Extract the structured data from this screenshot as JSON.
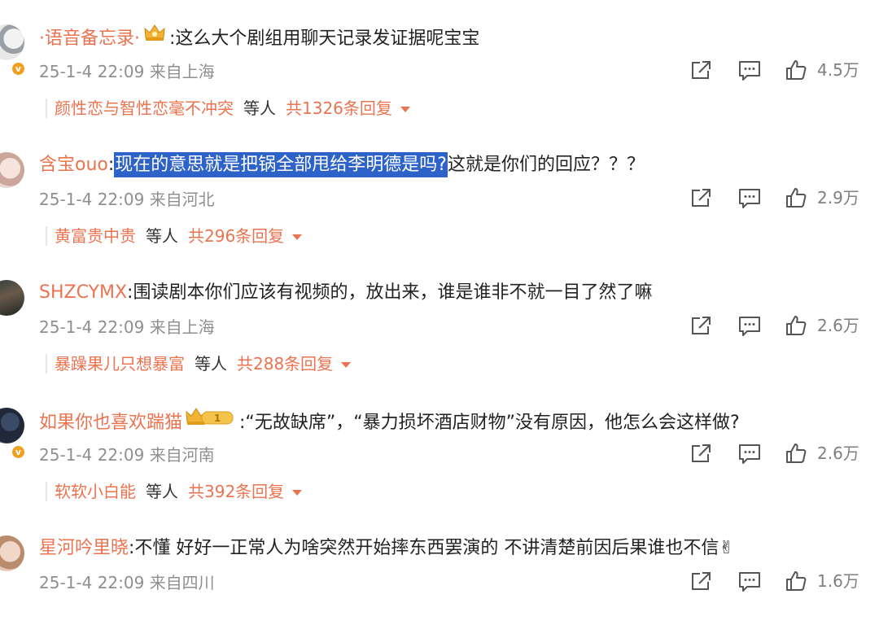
{
  "comments": [
    {
      "username": "·语音备忘录·",
      "medal": "crown-icon",
      "text_before": "",
      "text_highlight": "",
      "text_after": ":这么大个剧组用聊天记录发证据呢宝宝",
      "date": "25-1-4 22:09",
      "location": "来自上海",
      "likes": "4.5万",
      "reply_user": "颜性恋与智性恋毫不冲突",
      "reply_deng": "等人",
      "reply_total": "共1326条回复"
    },
    {
      "username": "含宝ouo",
      "medal": "",
      "text_before": ":",
      "text_highlight": "现在的意思就是把锅全部甩给李明德是吗?",
      "text_after": "这就是你们的回应？？？",
      "date": "25-1-4 22:09",
      "location": "来自河北",
      "likes": "2.9万",
      "reply_user": "黄富贵中贵",
      "reply_deng": "等人",
      "reply_total": "共296条回复"
    },
    {
      "username": "SHZCYMX",
      "medal": "",
      "text_before": "",
      "text_highlight": "",
      "text_after": ":围读剧本你们应该有视频的，放出来，谁是谁非不就一目了然了嘛",
      "date": "25-1-4 22:09",
      "location": "来自上海",
      "likes": "2.6万",
      "reply_user": "暴躁果儿只想暴富",
      "reply_deng": "等人",
      "reply_total": "共288条回复"
    },
    {
      "username": "如果你也喜欢踹猫",
      "medal": "crown-level-1-icon",
      "text_before": "",
      "text_highlight": "",
      "text_after": ":“无故缺席”，“暴力损坏酒店财物”没有原因，他怎么会这样做?",
      "date": "25-1-4 22:09",
      "location": "来自河南",
      "likes": "2.6万",
      "reply_user": "软软小白能",
      "reply_deng": "等人",
      "reply_total": "共392条回复"
    },
    {
      "username": "星河吟里晓",
      "medal": "",
      "text_before": "",
      "text_highlight": "",
      "text_after": ":不懂 好好一正常人为啥突然开始摔东西罢演的 不讲清楚前因后果谁也不信✌",
      "date": "25-1-4 22:09",
      "location": "来自四川",
      "likes": "1.6万",
      "reply_user": "",
      "reply_deng": "",
      "reply_total": ""
    }
  ],
  "colors": {
    "username": "#eb7350",
    "meta": "#8f8f8f",
    "highlight_bg": "#2d62c9",
    "verified_badge": "#f0a020"
  },
  "icons": {
    "share": "share-icon",
    "comment": "comment-icon",
    "like": "thumbs-up-icon",
    "expand": "caret-down-icon"
  }
}
